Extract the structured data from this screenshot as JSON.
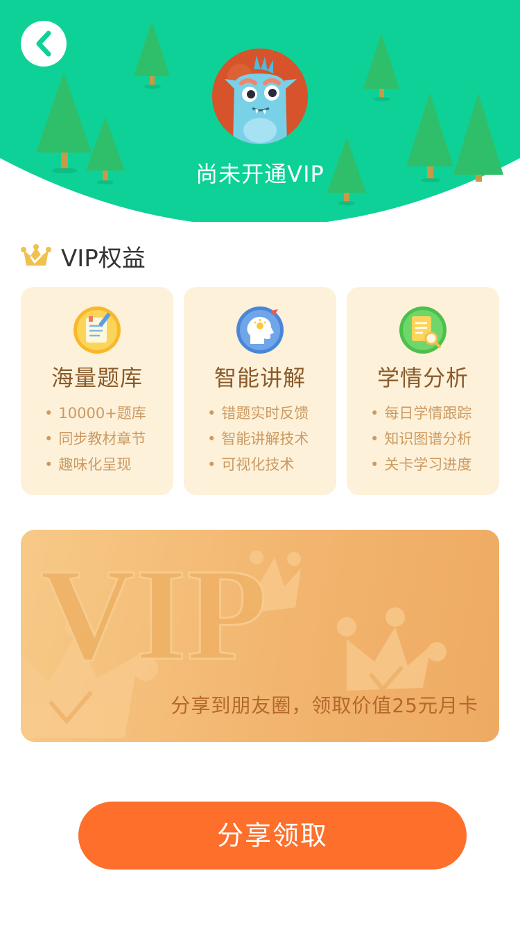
{
  "header": {
    "status_text": "尚未开通VIP",
    "background_color": "#0dd196",
    "back_icon": "chevron-left-icon",
    "avatar_icon": "monster-avatar-icon"
  },
  "benefits": {
    "section_title": "VIP权益",
    "title_icon": "crown-icon",
    "cards": [
      {
        "title": "海量题库",
        "icon": "notebook-pencil-icon",
        "items": [
          "10000+题库",
          "同步教材章节",
          "趣味化呈现"
        ]
      },
      {
        "title": "智能讲解",
        "icon": "head-lightbulb-icon",
        "items": [
          "错题实时反馈",
          "智能讲解技术",
          "可视化技术"
        ]
      },
      {
        "title": "学情分析",
        "icon": "document-magnifier-icon",
        "items": [
          "每日学情跟踪",
          "知识图谱分析",
          "关卡学习进度"
        ]
      }
    ]
  },
  "vip_card": {
    "watermark": "VIP",
    "promo_text": "分享到朋友圈，领取价值25元月卡"
  },
  "share_button": {
    "label": "分享领取",
    "color": "#fd6f2b"
  }
}
